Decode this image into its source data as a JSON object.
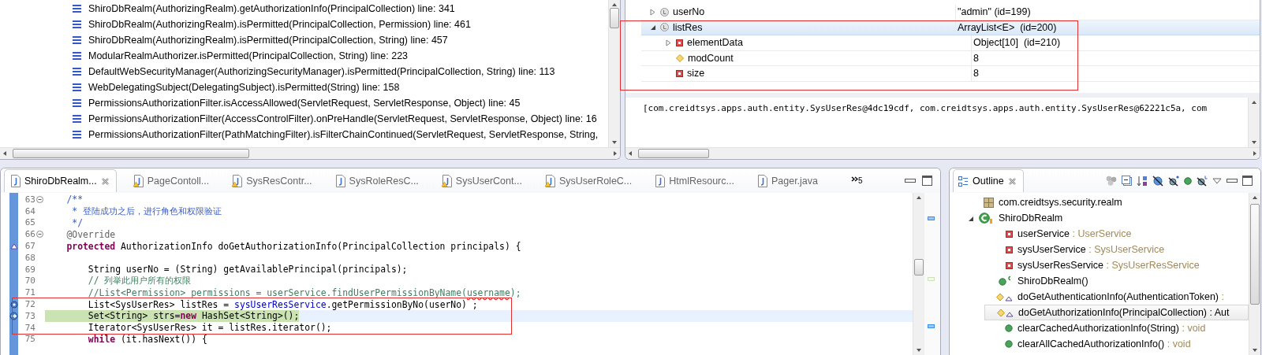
{
  "stack_frames": [
    {
      "label": "ShiroDbRealm(AuthorizingRealm).getAuthorizationInfo(PrincipalCollection) line: 341"
    },
    {
      "label": "ShiroDbRealm(AuthorizingRealm).isPermitted(PrincipalCollection, Permission) line: 461"
    },
    {
      "label": "ShiroDbRealm(AuthorizingRealm).isPermitted(PrincipalCollection, String) line: 457"
    },
    {
      "label": "ModularRealmAuthorizer.isPermitted(PrincipalCollection, String) line: 223"
    },
    {
      "label": "DefaultWebSecurityManager(AuthorizingSecurityManager).isPermitted(PrincipalCollection, String) line: 113"
    },
    {
      "label": "WebDelegatingSubject(DelegatingSubject).isPermitted(String) line: 158"
    },
    {
      "label": "PermissionsAuthorizationFilter.isAccessAllowed(ServletRequest, ServletResponse, Object) line: 45"
    },
    {
      "label": "PermissionsAuthorizationFilter(AccessControlFilter).onPreHandle(ServletRequest, ServletResponse, Object) line: 16"
    },
    {
      "label": "PermissionsAuthorizationFilter(PathMatchingFilter).isFilterChainContinued(ServletRequest, ServletResponse, String,"
    }
  ],
  "variables": {
    "rows": [
      {
        "name": "userNo",
        "value": "\"admin\" (id=199)",
        "kind": "local",
        "expanded": false,
        "selected": false
      },
      {
        "name": "listRes",
        "value": "ArrayList<E>  (id=200)",
        "kind": "local",
        "expanded": true,
        "selected": true,
        "children": [
          {
            "name": "elementData",
            "value": "Object[10]  (id=210)",
            "kind": "private",
            "expanded": false,
            "selected": false
          },
          {
            "name": "modCount",
            "value": "8",
            "kind": "default",
            "selected": false
          },
          {
            "name": "size",
            "value": "8",
            "kind": "private",
            "selected": false
          }
        ]
      }
    ],
    "detail": "[com.creidtsys.apps.auth.entity.SysUserRes@4dc19cdf, com.creidtsys.apps.auth.entity.SysUserRes@62221c5a, com"
  },
  "editor": {
    "tabs": [
      {
        "label": "ShiroDbRealm...",
        "selected": true,
        "warning": false
      },
      {
        "label": "PageContoll...",
        "selected": false,
        "warning": true
      },
      {
        "label": "SysResContr...",
        "selected": false,
        "warning": true
      },
      {
        "label": "SysRoleResC...",
        "selected": false,
        "warning": false
      },
      {
        "label": "SysUserCont...",
        "selected": false,
        "warning": true
      },
      {
        "label": "SysUserRoleC...",
        "selected": false,
        "warning": true
      },
      {
        "label": "HtmlResourc...",
        "selected": false,
        "warning": false
      },
      {
        "label": "Pager.java",
        "selected": false,
        "warning": false
      }
    ],
    "overflow_count": "5",
    "lines": [
      {
        "number": "63",
        "fold": true,
        "segments": [
          {
            "text": "    /**",
            "kind": "javadoc"
          }
        ]
      },
      {
        "number": "64",
        "segments": [
          {
            "text": "     * 登陆成功之后，进行角色和权限验证",
            "kind": "javadoc"
          }
        ]
      },
      {
        "number": "65",
        "segments": [
          {
            "text": "     */",
            "kind": "javadoc"
          }
        ]
      },
      {
        "number": "66",
        "fold": true,
        "segments": [
          {
            "text": "    @Override",
            "kind": "annotation"
          }
        ]
      },
      {
        "number": "67",
        "override": true,
        "segments": [
          {
            "text": "    protected",
            "kind": "keyword"
          },
          {
            "text": " AuthorizationInfo doGetAuthorizationInfo(PrincipalCollection principals) {",
            "kind": "plain"
          }
        ]
      },
      {
        "number": "68"
      },
      {
        "number": "69",
        "segments": [
          {
            "text": "        String userNo = (String) getAvailablePrincipal(principals);",
            "kind": "plain"
          }
        ]
      },
      {
        "number": "70",
        "segments": [
          {
            "text": "        // 列举此用户所有的权限",
            "kind": "comment"
          }
        ]
      },
      {
        "number": "71",
        "segments": [
          {
            "text": "        //List<Permission> permissions = userService.findUserPermissionByName(",
            "kind": "comment"
          },
          {
            "text": "username",
            "kind": "comment-misspelled"
          },
          {
            "text": ");",
            "kind": "comment"
          }
        ]
      },
      {
        "number": "72",
        "breakpoint": true,
        "segments": [
          {
            "text": "        List<SysUserRes> listRes = ",
            "kind": "plain"
          },
          {
            "text": "sysUserResService",
            "kind": "field"
          },
          {
            "text": ".getPermissionByNo(userNo) ;",
            "kind": "plain"
          }
        ]
      },
      {
        "number": "73",
        "breakpoint": true,
        "instruction_pointer": true,
        "current": true,
        "debug_highlight": true,
        "segments": [
          {
            "text": "        Set<String> strs=",
            "kind": "plain"
          },
          {
            "text": "new",
            "kind": "keyword"
          },
          {
            "text": " HashSet<String>();",
            "kind": "plain"
          }
        ]
      },
      {
        "number": "74",
        "segments": [
          {
            "text": "        Iterator<SysUserRes> it = listRes.iterator();",
            "kind": "plain"
          }
        ]
      },
      {
        "number": "75",
        "segments": [
          {
            "text": "        while",
            "kind": "keyword"
          },
          {
            "text": " (it.hasNext()) {",
            "kind": "plain"
          }
        ]
      }
    ]
  },
  "outline": {
    "title": "Outline",
    "items": [
      {
        "label": "com.creidtsys.security.realm",
        "kind": "package",
        "selected": false
      },
      {
        "label": "ShiroDbRealm",
        "kind": "class",
        "expanded": true,
        "selected": false,
        "children": [
          {
            "label": "userService",
            "type": ": UserService",
            "kind": "field-private",
            "selected": false
          },
          {
            "label": "sysUserService",
            "type": ": SysUserService",
            "kind": "field-private",
            "selected": false
          },
          {
            "label": "sysUserResService",
            "type": ": SysUserResService",
            "kind": "field-private",
            "selected": false
          },
          {
            "label": "ShiroDbRealm()",
            "kind": "constructor",
            "selected": false
          },
          {
            "label": "doGetAuthenticationInfo(AuthenticationToken)",
            "type": ":",
            "kind": "method-override",
            "selected": false
          },
          {
            "label": "doGetAuthorizationInfo(PrincipalCollection)",
            "type": ": Aut",
            "kind": "method-override",
            "selected": true
          },
          {
            "label": "clearCachedAuthorizationInfo(String)",
            "type": ": void",
            "kind": "method-public",
            "selected": false
          },
          {
            "label": "clearAllCachedAuthorizationInfo()",
            "type": ": void",
            "kind": "method-public",
            "selected": false
          }
        ]
      }
    ]
  }
}
